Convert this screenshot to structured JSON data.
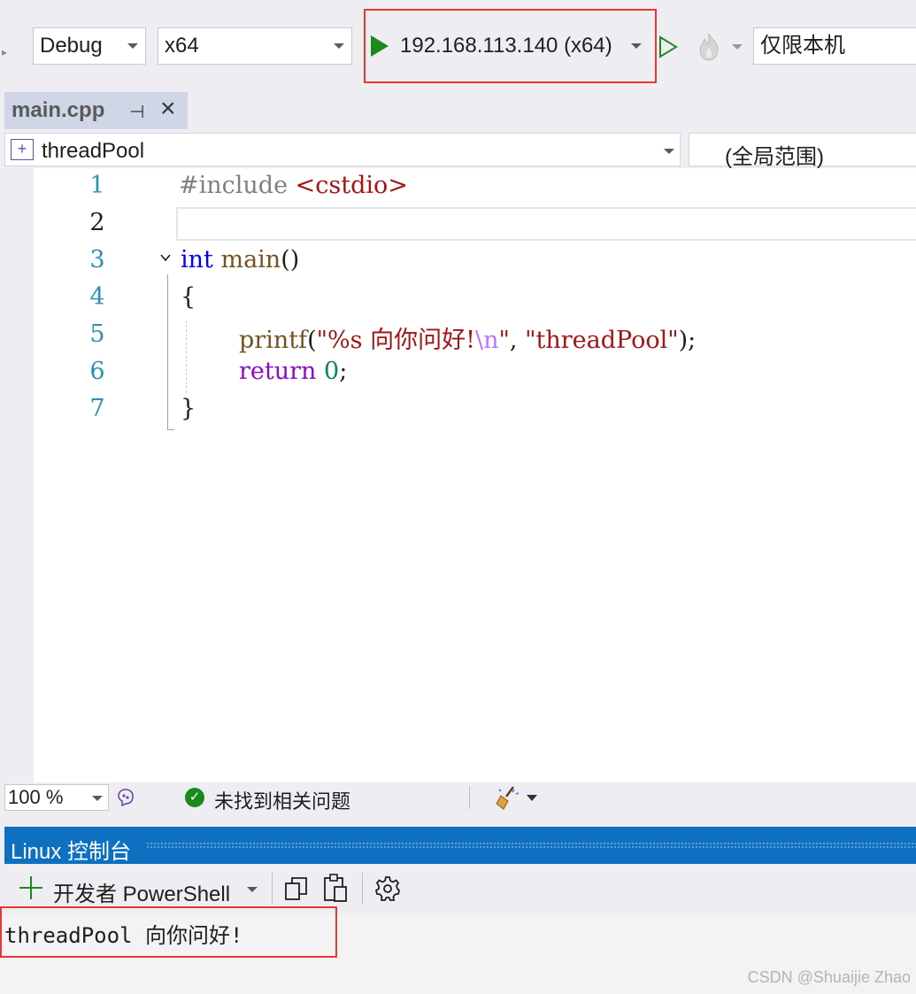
{
  "window": {
    "title": "main.cpp"
  },
  "toolbar": {
    "configuration": "Debug",
    "platform": "x64",
    "target": "192.168.113.140 (x64)",
    "scope": "仅限本机",
    "accent_red": "#e53935",
    "play_green": "#1a8a1a"
  },
  "tab": {
    "name": "main.cpp",
    "pin_icon": "pin-icon",
    "close_icon": "close-icon"
  },
  "navbar": {
    "member": "threadPool",
    "scope": "(全局范围)"
  },
  "editor": {
    "line_numbers": [
      "1",
      "2",
      "3",
      "4",
      "5",
      "6",
      "7"
    ],
    "current_line": 2,
    "lines": {
      "l1_pp": "#include",
      "l1_str": "<cstdio>",
      "l3_kw": "int",
      "l3_fn": "main",
      "l3_rest": "()",
      "l4": "{",
      "l5_fn": "printf",
      "l5_open": "(",
      "l5_str1": "\"%s 向你问好!",
      "l5_esc": "\\n",
      "l5_str1_end": "\"",
      "l5_sep": ", ",
      "l5_str2": "\"threadPool\"",
      "l5_end": ");",
      "l6_kw": "return",
      "l6_num": "0",
      "l6_end": ";",
      "l7": "}"
    }
  },
  "statusbar": {
    "zoom": "100 %",
    "issues": "未找到相关问题"
  },
  "panel": {
    "title": "Linux 控制台",
    "shell": "开发者 PowerShell",
    "output": "threadPool 向你问好!"
  },
  "watermark": "CSDN @Shuaijie Zhao"
}
